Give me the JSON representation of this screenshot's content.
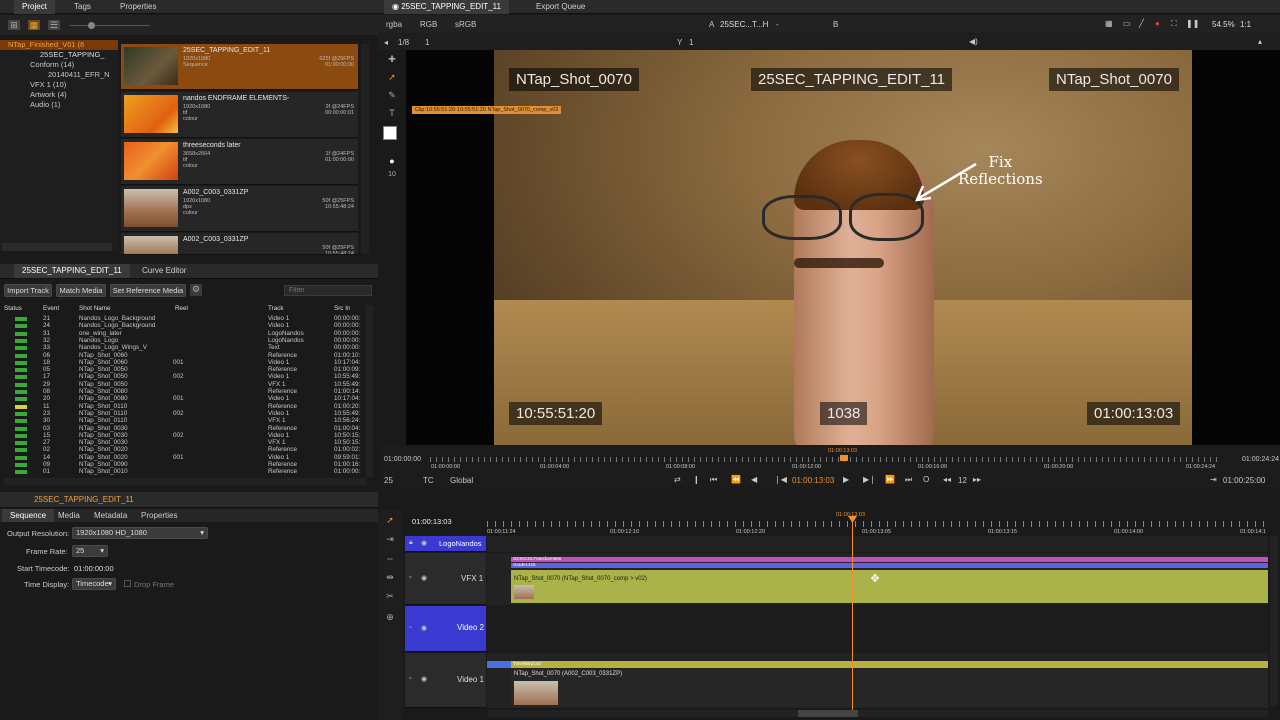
{
  "project_panel": {
    "tabs": [
      "Project",
      "Tags",
      "Properties"
    ],
    "tree": [
      "NTap_Finished_V01 (6",
      "25SEC_TAPPING_",
      "Conform (14)",
      "20140411_EFR_N",
      "VFX 1 (10)",
      "Artwork (4)",
      "Audio (1)"
    ],
    "clips": [
      {
        "name": "25SEC_TAPPING_EDIT_11",
        "meta": "1920x1080\nSequence",
        "right": "625f @25FPS\n01:00:00:00"
      },
      {
        "name": "nandos ENDFRAME ELEMENTS-",
        "meta": "1920x1080\ntif\ncolour",
        "right": "2f @24FPS\n00:00:00:01"
      },
      {
        "name": "threeseconds later",
        "meta": "3658x2664\ntif\ncolour",
        "right": "1f @24FPS\n01:00:00:00"
      },
      {
        "name": "A002_C003_0331ZP",
        "meta": "1920x1080\ndpx\ncolour",
        "right": "50f @25FPS\n10:55:48:24"
      },
      {
        "name": "A002_C003_0331ZP",
        "meta": "",
        "right": "50f @25FPS\n10:55:48:24"
      }
    ]
  },
  "shots_panel": {
    "tabs": [
      "25SEC_TAPPING_EDIT_11",
      "Curve Editor"
    ],
    "buttons": [
      "Import Track",
      "Match Media",
      "Set Reference Media"
    ],
    "filter_placeholder": "Filter",
    "columns": [
      "Status",
      "Event",
      "Shot Name",
      "Reel",
      "Track",
      "Src In"
    ],
    "rows": [
      {
        "event": "21",
        "shot": "Nandos_Logo_Background",
        "reel": "",
        "track": "Video 1",
        "src": "00:00:00:"
      },
      {
        "event": "24",
        "shot": "Nandos_Logo_Background",
        "reel": "",
        "track": "Video 1",
        "src": "00:00:00:"
      },
      {
        "event": "31",
        "shot": "one_wing_later",
        "reel": "",
        "track": "LogoNandos",
        "src": "00:00:00:"
      },
      {
        "event": "32",
        "shot": "Nandos_Logo",
        "reel": "",
        "track": "LogoNandos",
        "src": "00:00:00:"
      },
      {
        "event": "33",
        "shot": "Nandos_Logo_Wings_V",
        "reel": "",
        "track": "Text",
        "src": "00:00:00:"
      },
      {
        "event": "06",
        "shot": "NTap_Shot_0060",
        "reel": "",
        "track": "Reference",
        "src": "01:00:10:"
      },
      {
        "event": "18",
        "shot": "NTap_Shot_0060",
        "reel": "001",
        "track": "Video 1",
        "src": "10:17:04:"
      },
      {
        "event": "05",
        "shot": "NTap_Shot_0050",
        "reel": "",
        "track": "Reference",
        "src": "01:00:09:"
      },
      {
        "event": "17",
        "shot": "NTap_Shot_0050",
        "reel": "002",
        "track": "Video 1",
        "src": "10:55:49:"
      },
      {
        "event": "29",
        "shot": "NTap_Shot_0050",
        "reel": "",
        "track": "VFX 1",
        "src": "10:55:49:"
      },
      {
        "event": "08",
        "shot": "NTap_Shot_0080",
        "reel": "",
        "track": "Reference",
        "src": "01:00:14:"
      },
      {
        "event": "20",
        "shot": "NTap_Shot_0080",
        "reel": "001",
        "track": "Video 1",
        "src": "10:17:04:"
      },
      {
        "event": "11",
        "shot": "NTap_Shot_0110",
        "reel": "",
        "track": "Reference",
        "src": "01:00:20:"
      },
      {
        "event": "23",
        "shot": "NTap_Shot_0110",
        "reel": "002",
        "track": "Video 1",
        "src": "10:55:49:"
      },
      {
        "event": "30",
        "shot": "NTap_Shot_0110",
        "reel": "",
        "track": "VFX 1",
        "src": "10:56:24:"
      },
      {
        "event": "03",
        "shot": "NTap_Shot_0030",
        "reel": "",
        "track": "Reference",
        "src": "01:00:04:"
      },
      {
        "event": "15",
        "shot": "NTap_Shot_0030",
        "reel": "002",
        "track": "Video 1",
        "src": "10:50:15:"
      },
      {
        "event": "27",
        "shot": "NTap_Shot_0030",
        "reel": "",
        "track": "VFX 1",
        "src": "10:50:15:"
      },
      {
        "event": "02",
        "shot": "NTap_Shot_0020",
        "reel": "",
        "track": "Reference",
        "src": "01:00:02:"
      },
      {
        "event": "14",
        "shot": "NTap_Shot_0020",
        "reel": "001",
        "track": "Video 1",
        "src": "09:59:01:"
      },
      {
        "event": "09",
        "shot": "NTap_Shot_0090",
        "reel": "",
        "track": "Reference",
        "src": "01:00:16:"
      },
      {
        "event": "01",
        "shot": "NTap_Shot_0010",
        "reel": "",
        "track": "Reference",
        "src": "01:00:00:"
      }
    ]
  },
  "props_panel": {
    "title": "25SEC_TAPPING_EDIT_11",
    "tabs": [
      "Sequence",
      "Media",
      "Metadata",
      "Properties"
    ],
    "output_resolution_label": "Output Resolution:",
    "output_resolution": "1920x1080 HD_1080",
    "frame_rate_label": "Frame Rate:",
    "frame_rate": "25",
    "start_timecode_label": "Start Timecode:",
    "start_timecode": "01:00:00:00",
    "time_display_label": "Time Display:",
    "time_display": "Timecode",
    "drop_frame": "Drop Frame"
  },
  "viewer": {
    "tabs": [
      "25SEC_TAPPING_EDIT_11",
      "Export Queue"
    ],
    "channel": "rgba",
    "colorspace1": "RGB",
    "colorspace2": "sRGB",
    "a_label": "A",
    "a_clip": "25SEC...T...H",
    "b_label": "B",
    "zoom": "54.5%",
    "ratio": "1:1",
    "frame_label": "1/8",
    "frame_value": "1",
    "y_label": "Y",
    "y_value": "1",
    "clip_banner": "Clip:10:55:51:20-10:55:51:20 NTap_Shot_0070_comp_v02",
    "overlay_tl": "NTap_Shot_0070",
    "overlay_tc": "25SEC_TAPPING_EDIT_11",
    "overlay_tr": "NTap_Shot_0070",
    "overlay_bl": "10:55:51:20",
    "overlay_bc": "1038",
    "overlay_br": "01:00:13:03",
    "annotation": "Fix\nReflections",
    "brush_size": "10",
    "ruler_start": "01:00:00:00",
    "ruler_end": "01:00:24:24",
    "ruler_ticks": [
      "01:00:00:00",
      "01:00:04:00",
      "01:00:08:00",
      "01:00:12:00",
      "01:00:16:00",
      "01:00:20:00",
      "01:00:24:24"
    ],
    "playhead_tc": "01:00:13:03",
    "current_tc": "01:00:13:03",
    "fps": "25",
    "tc_mode": "TC",
    "scope": "Global",
    "step": "12",
    "duration": "01:00:25:00"
  },
  "timeline": {
    "current_tc": "01:00:13:03",
    "playhead_tc": "01:00:13:03",
    "ruler_ticks": [
      "01:00:11:24",
      "01:00:12:10",
      "01:00:12:20",
      "01:00:13:05",
      "01:00:13:15",
      "01:00:14:00",
      "01:00:14:1"
    ],
    "tracks": [
      {
        "name": "LogoNandos"
      },
      {
        "name": "VFX 1"
      },
      {
        "name": "Video 2"
      },
      {
        "name": "Video 1"
      }
    ],
    "vfx_layers": [
      "OCIOCOLTransform666",
      "Grade1425"
    ],
    "vfx_clip": "NTap_Shot_0070 (NTap_Shot_0070_comp > v02)",
    "video1_layer": "TimeWarp143",
    "video1_clip": "NTap_Shot_0070 (A002_C003_0331ZP)"
  },
  "colors": {
    "accent": "#f09030",
    "clip_green": "#a9b34a",
    "track_blue": "#3a3ad0"
  }
}
